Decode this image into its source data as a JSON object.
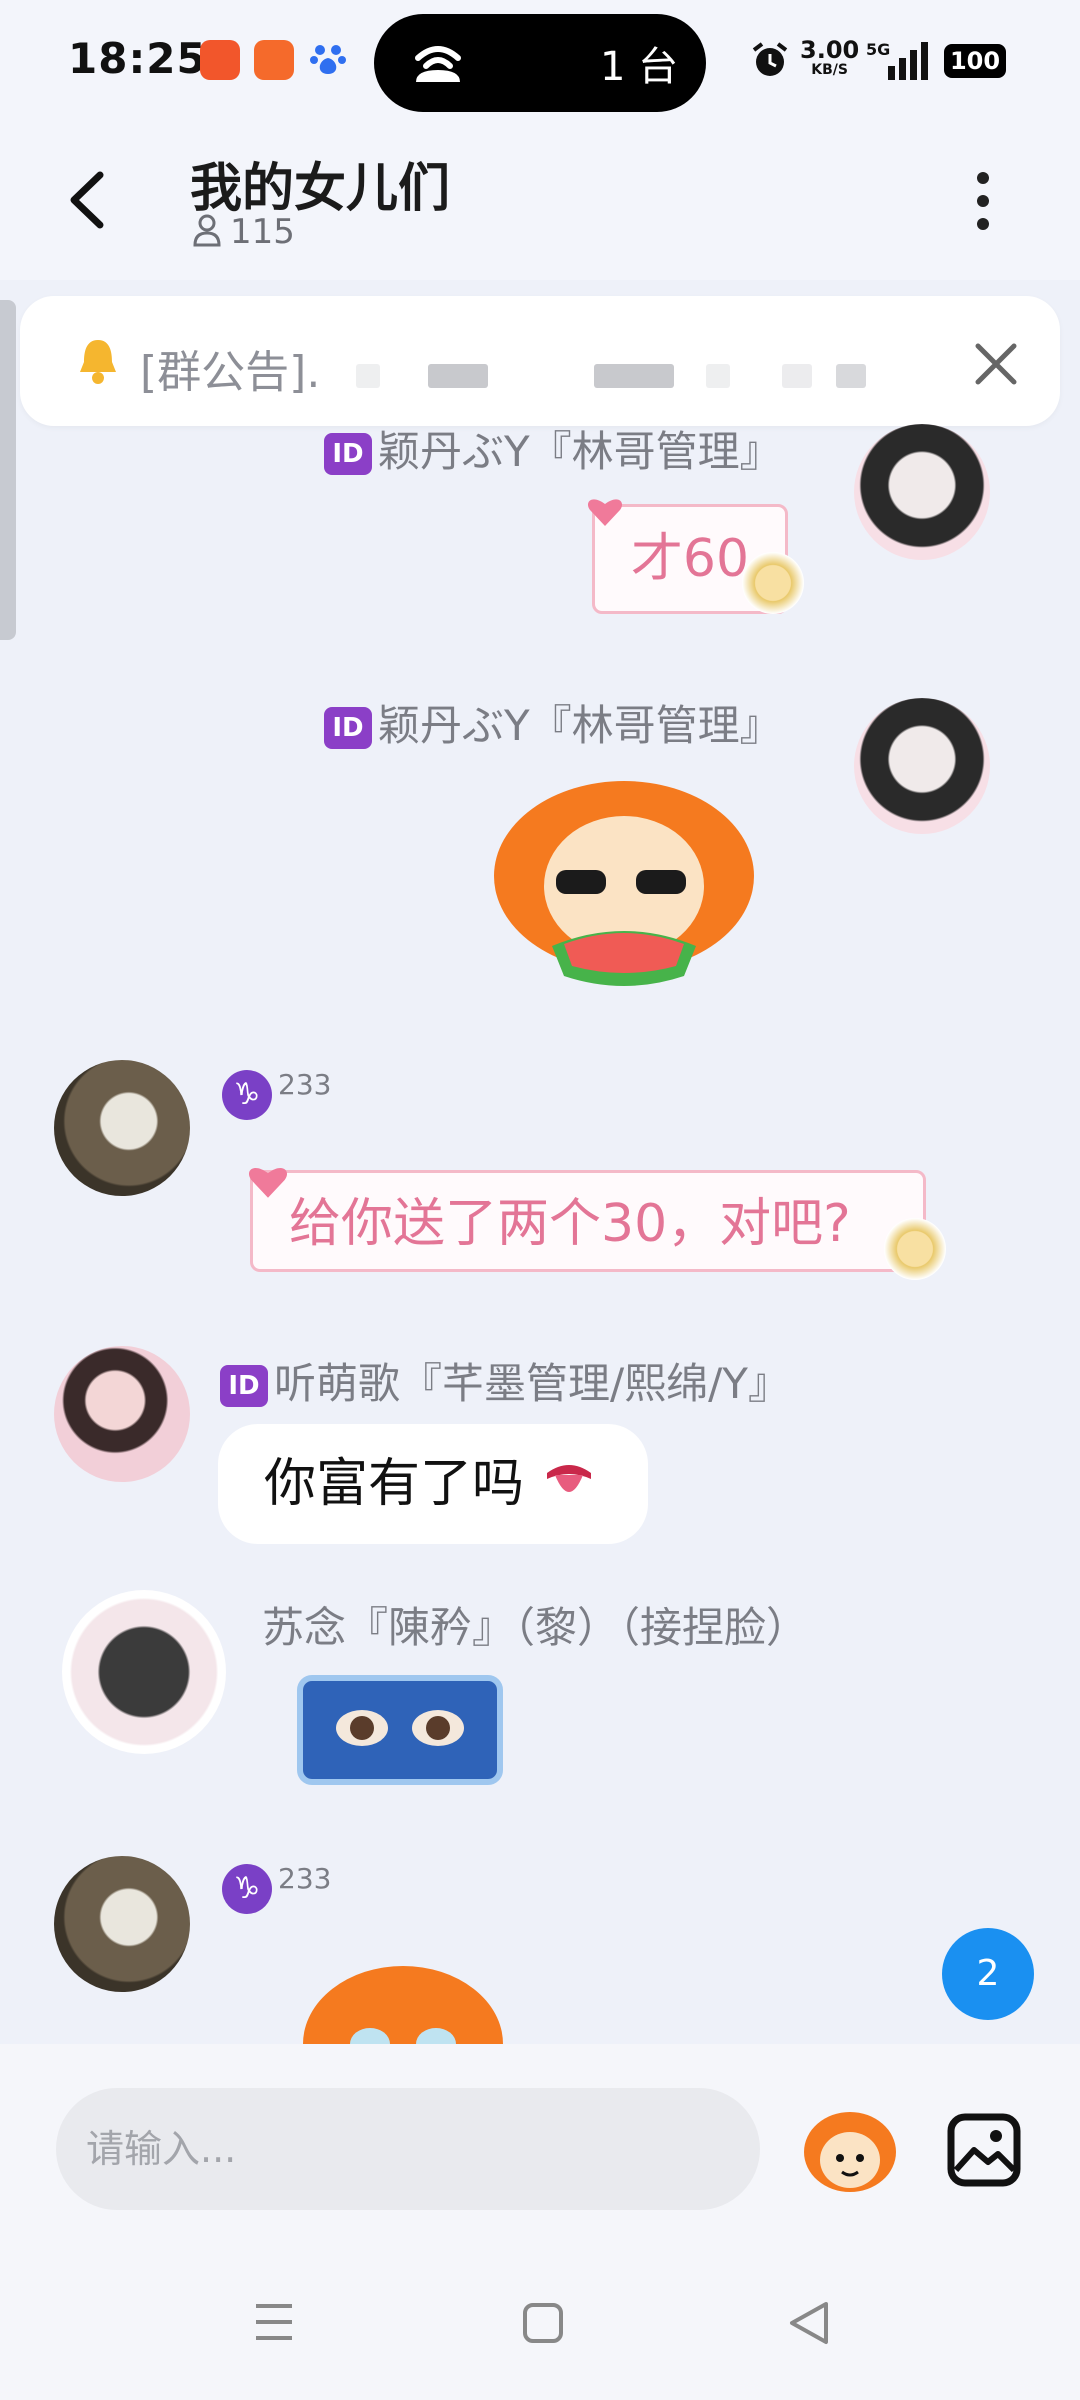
{
  "status_bar": {
    "time": "18:25",
    "hotspot_text": "1 台",
    "net_speed": "3.00",
    "net_unit": "KB/S",
    "signal": "5G",
    "battery": "100"
  },
  "header": {
    "title": "我的女儿们",
    "member_count": "115"
  },
  "announcement": {
    "text": "[群公告]."
  },
  "messages": [
    {
      "sender": "颖丹ぶY『林哥管理』",
      "badge": "ID",
      "text": "才60",
      "side": "right"
    },
    {
      "sender": "颖丹ぶY『林哥管理』",
      "badge": "ID",
      "sticker": "watermelon-sticker",
      "side": "right"
    },
    {
      "sender": "233",
      "level_symbol": "♑",
      "text": "给你送了两个30，对吧?",
      "side": "left"
    },
    {
      "sender": "听萌歌『芊墨管理/熙绵/Y』",
      "badge": "ID",
      "text": "你富有了吗",
      "side": "left"
    },
    {
      "sender": "苏念『陳矜』（黎）（接捏脸）",
      "sticker": "eyes-sticker",
      "side": "left"
    },
    {
      "sender": "233",
      "level_symbol": "♑",
      "sticker": "orange-sticker",
      "side": "left"
    }
  ],
  "new_messages_count": "2",
  "input": {
    "placeholder": "请输入..."
  },
  "colors": {
    "accent": "#1a90f1",
    "pink_text": "#e37596",
    "id_badge": "#8b3fc7"
  }
}
